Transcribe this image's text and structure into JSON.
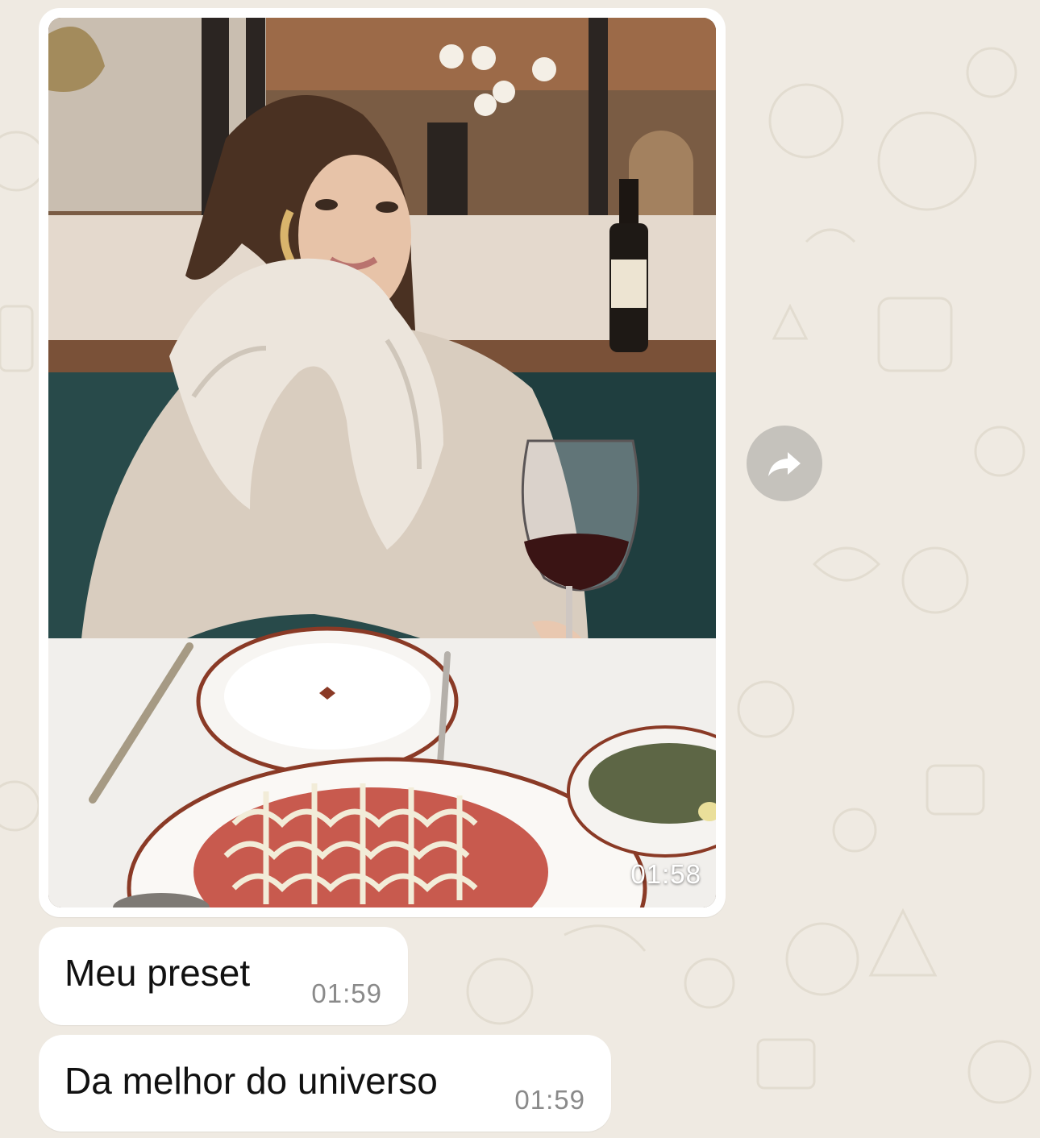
{
  "chat": {
    "background_color": "#efeae2",
    "bubble_color": "#ffffff",
    "messages": [
      {
        "type": "image",
        "time": "01:58",
        "image_description": "woman in fur coat at restaurant table with wine glass and carpaccio plate"
      },
      {
        "type": "text",
        "text": "Meu preset",
        "time": "01:59"
      },
      {
        "type": "text",
        "text": "Da melhor do universo",
        "time": "01:59"
      }
    ],
    "forward_icon": "forward-arrow-icon"
  }
}
